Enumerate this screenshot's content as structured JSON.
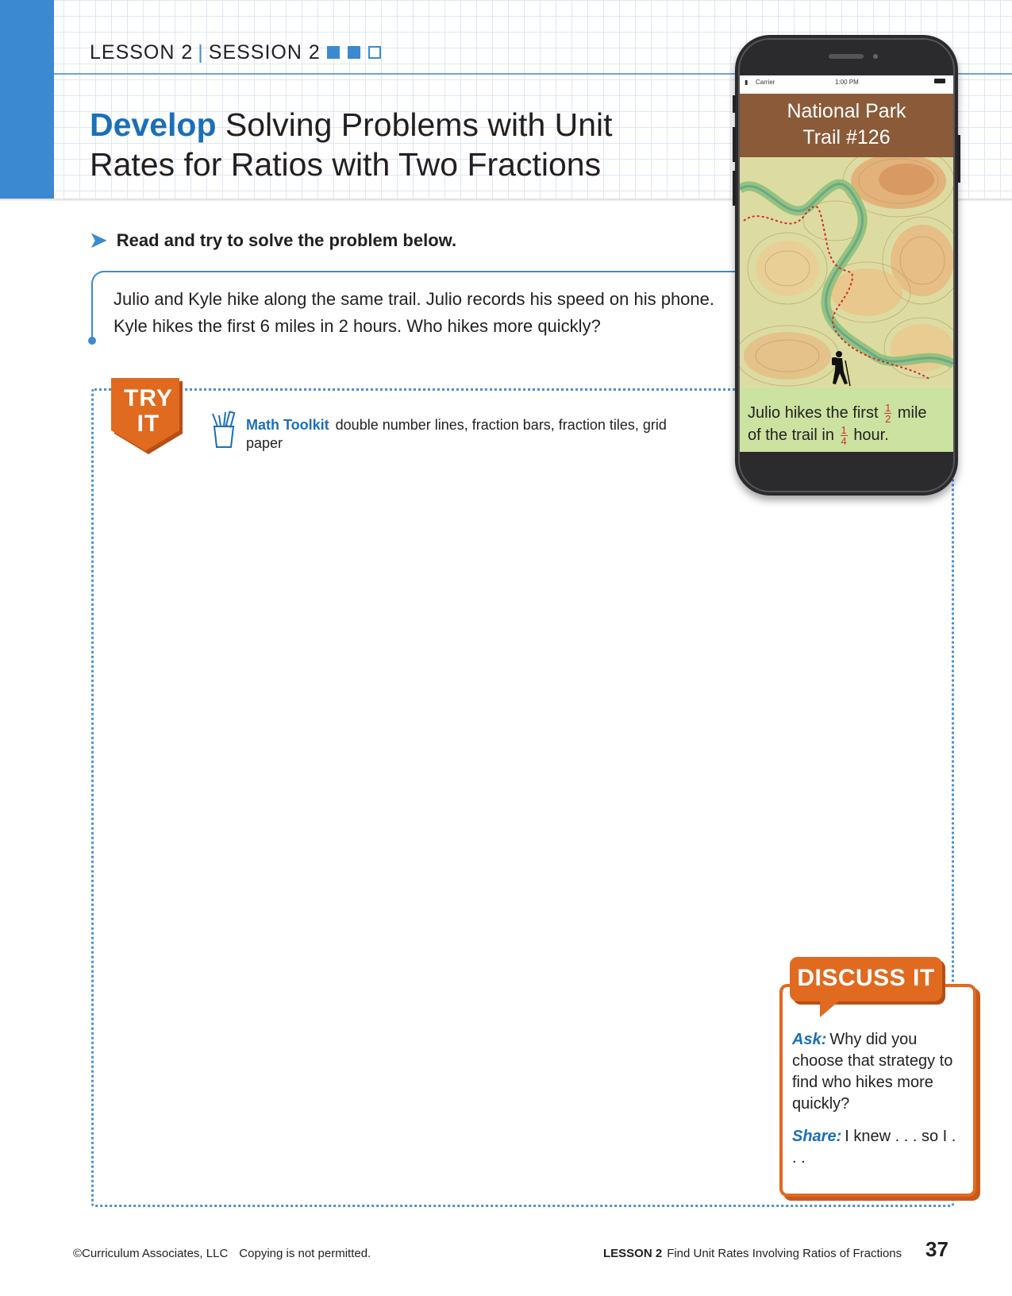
{
  "header": {
    "lesson": "LESSON 2",
    "session": "SESSION 2",
    "session_progress": {
      "completed": 2,
      "total": 3
    },
    "title_keyword": "Develop",
    "title_rest": "Solving Problems with Unit Rates for Ratios with Two Fractions"
  },
  "instruction": "Read and try to solve the problem below.",
  "problem": "Julio and Kyle hike along the same trail. Julio records his speed on his phone. Kyle hikes the first 6 miles in 2 hours. Who hikes more quickly?",
  "try_it": {
    "badge_line1": "TRY",
    "badge_line2": "IT",
    "toolkit_label": "Math Toolkit",
    "toolkit_items": "double number lines, fraction bars, fraction tiles, grid paper"
  },
  "phone": {
    "carrier": "Carrier",
    "time": "1:00 PM",
    "park_line1": "National Park",
    "park_line2": "Trail #126",
    "caption_part1": "Julio hikes the first",
    "fraction1": {
      "num": "1",
      "den": "2"
    },
    "caption_part2": "mile",
    "caption_part3": "of the trail in",
    "fraction2": {
      "num": "1",
      "den": "4"
    },
    "caption_part4": "hour."
  },
  "discuss": {
    "title": "DISCUSS IT",
    "ask_label": "Ask:",
    "ask_text": "Why did you choose that strategy to find who hikes more quickly?",
    "share_label": "Share:",
    "share_text": "I knew . . . so I . . ."
  },
  "footer": {
    "copyright": "©Curriculum Associates, LLC",
    "notice": "Copying is not permitted.",
    "lesson": "LESSON 2",
    "lesson_title": "Find Unit Rates Involving Ratios of Fractions",
    "page_number": "37"
  },
  "colors": {
    "accent_blue": "#3b8ad1",
    "title_blue": "#1b6fb9",
    "orange": "#e06a1f",
    "trail_brown": "#8b5a38",
    "fraction_red": "#d32f2f"
  }
}
